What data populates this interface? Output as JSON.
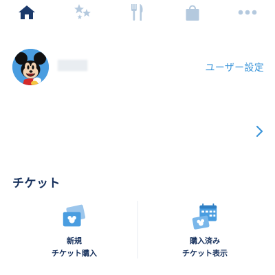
{
  "tabs": [
    {
      "icon": "home-icon",
      "active": true
    },
    {
      "icon": "stars-icon",
      "active": false
    },
    {
      "icon": "dining-icon",
      "active": false
    },
    {
      "icon": "shopping-bag-icon",
      "active": false
    },
    {
      "icon": "more-icon",
      "active": false
    }
  ],
  "colors": {
    "tab_active": "#1b3a6b",
    "tab_inactive": "#b4c9de",
    "accent": "#3b95d9",
    "title": "#16305c",
    "ticket_icon": "#4a9de0"
  },
  "profile": {
    "avatar_icon": "mickey-avatar",
    "settings_label": "ユーザー設定"
  },
  "tickets": {
    "section_title": "チケット",
    "tiles": [
      {
        "line1": "新規",
        "line2": "チケット購入",
        "icon": "ticket-purchase-icon"
      },
      {
        "line1": "購入済み",
        "line2": "チケット表示",
        "icon": "ticket-calendar-icon"
      }
    ]
  }
}
